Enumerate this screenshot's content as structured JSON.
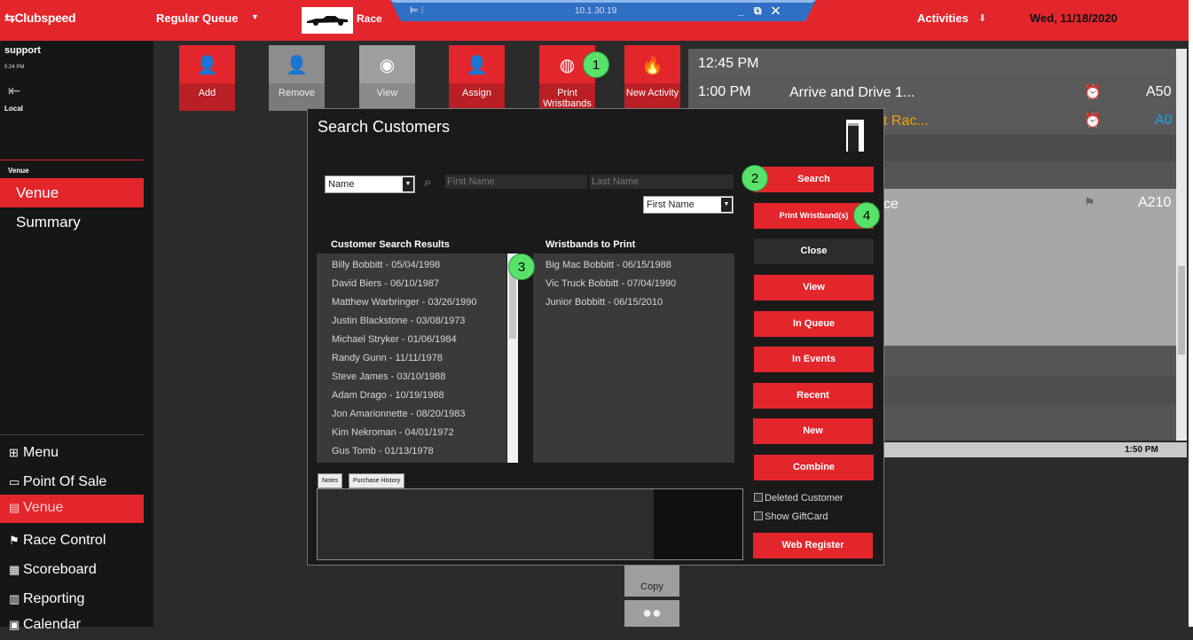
{
  "topbar": {
    "logo": "Clubspeed",
    "queue_label": "Regular Queue",
    "race_label": "Race",
    "remote_ip": "10.1.30.19",
    "remote_controls": "_ ⧉ ✕",
    "activities_label": "Activities",
    "date": "Wed, 11/18/2020"
  },
  "sidebar": {
    "user": "support",
    "time": "5:24 PM",
    "location": "Local",
    "section_header": "Venue",
    "nav": [
      "Venue",
      "Summary"
    ],
    "menu": [
      {
        "icon": "grid-icon",
        "label": "Menu"
      },
      {
        "icon": "card-icon",
        "label": "Point Of Sale"
      },
      {
        "icon": "venue-icon",
        "label": "Venue"
      },
      {
        "icon": "flag-icon",
        "label": "Race Control"
      },
      {
        "icon": "scoreboard-icon",
        "label": "Scoreboard"
      },
      {
        "icon": "chart-icon",
        "label": "Reporting"
      },
      {
        "icon": "calendar-icon",
        "label": "Calendar"
      }
    ]
  },
  "actions": {
    "add": "Add",
    "remove": "Remove",
    "view": "View",
    "assign": "Assign",
    "print_wristbands": "Print Wristbands",
    "new_activity": "New Activity",
    "copy": "Copy"
  },
  "badges": [
    "1",
    "2",
    "3",
    "4"
  ],
  "schedule": {
    "rows": [
      {
        "time": "12:45 PM",
        "name": "",
        "code": ""
      },
      {
        "time": "1:00 PM",
        "name": "Arrive and Drive 1...",
        "code": "A50"
      },
      {
        "time": "",
        "name": "t Rac...",
        "code": "A0"
      },
      {
        "time": "",
        "name": "ce",
        "code": "A210"
      }
    ],
    "timeline_label": "1:50 PM"
  },
  "modal": {
    "title": "Search Customers",
    "search_by": "Name",
    "first_name_placeholder": "First Name",
    "last_name_placeholder": "Last Name",
    "sort_by": "First Name",
    "results_header": "Customer Search Results",
    "wristbands_header": "Wristbands to Print",
    "results": [
      "Billy Bobbitt - 05/04/1998",
      "David Biers - 06/10/1987",
      "Matthew Warbringer - 03/26/1990",
      "Justin Blackstone - 03/08/1973",
      "Michael Stryker - 01/06/1984",
      "Randy Gunn - 11/11/1978",
      "Steve James - 03/10/1988",
      "Adam Drago - 10/19/1988",
      "Jon Amarionnette - 08/20/1983",
      "Kim Nekroman - 04/01/1972",
      "Gus Tomb - 01/13/1978"
    ],
    "wristbands": [
      "Big Mac Bobbitt - 06/15/1988",
      "Vic Truck Bobbitt - 07/04/1990",
      "Junior Bobbitt - 06/15/2010"
    ],
    "tabs": [
      "Notes",
      "Purchase History"
    ],
    "buttons": {
      "search": "Search",
      "print_wristbands": "Print Wristband(s)",
      "close": "Close",
      "view": "View",
      "in_queue": "In Queue",
      "in_events": "In Events",
      "recent": "Recent",
      "new": "New",
      "combine": "Combine",
      "web_register": "Web Register"
    },
    "checkboxes": [
      "Deleted Customer",
      "Show GiftCard"
    ]
  },
  "colors": {
    "brand_red": "#e2262c",
    "badge_green": "#59e26a",
    "schedule_orange": "#f4a300",
    "schedule_blue": "#1aa6e8"
  }
}
